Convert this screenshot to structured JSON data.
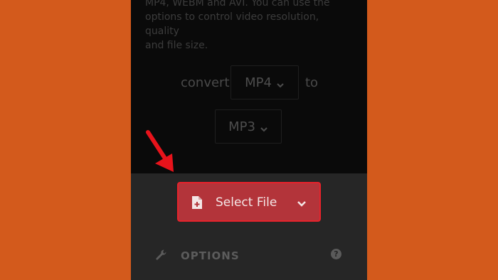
{
  "description": "MP4, WEBM and AVI. You can use the\noptions to control video resolution, quality\nand file size.",
  "converter": {
    "convert_label": "convert",
    "from_format": "MP4",
    "to_label": "to",
    "to_format": "MP3"
  },
  "upload": {
    "select_file_label": "Select File"
  },
  "options": {
    "label": "OPTIONS",
    "help_glyph": "?"
  },
  "icons": {
    "file": "file-plus-icon",
    "dropdown": "chevron-down-icon",
    "wrench": "wrench-icon",
    "help": "question-circle-icon",
    "annotation": "red-arrow-icon"
  },
  "colors": {
    "background": "#d35a1c",
    "button_fill": "#b3343a",
    "button_border": "#e8222b",
    "annotation_arrow": "#e8131b"
  }
}
